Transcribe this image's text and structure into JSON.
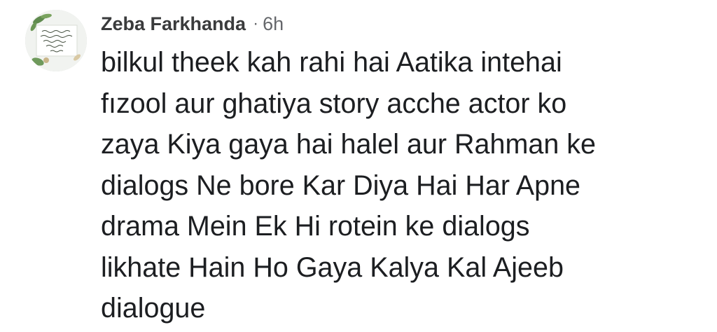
{
  "comment": {
    "author": "Zeba Farkhanda",
    "separator": "·",
    "time": "6h",
    "avatar_icon": "profile-picture-calligraphy",
    "text_lines": [
      "bilkul theek kah rahi hai Aatika intehai",
      "fızool aur ghatiya story acche actor ko",
      "zaya Kiya gaya hai halel aur Rahman ke",
      "dialogs Ne bore Kar Diya Hai Har Apne",
      "drama Mein Ek Hi rotein ke dialogs",
      "likhate Hain Ho Gaya Kalya Kal Ajeeb",
      "dialogue"
    ]
  },
  "colors": {
    "author": "#3a3b3c",
    "meta": "#65676b",
    "text": "#1c1e21",
    "background": "#ffffff"
  }
}
